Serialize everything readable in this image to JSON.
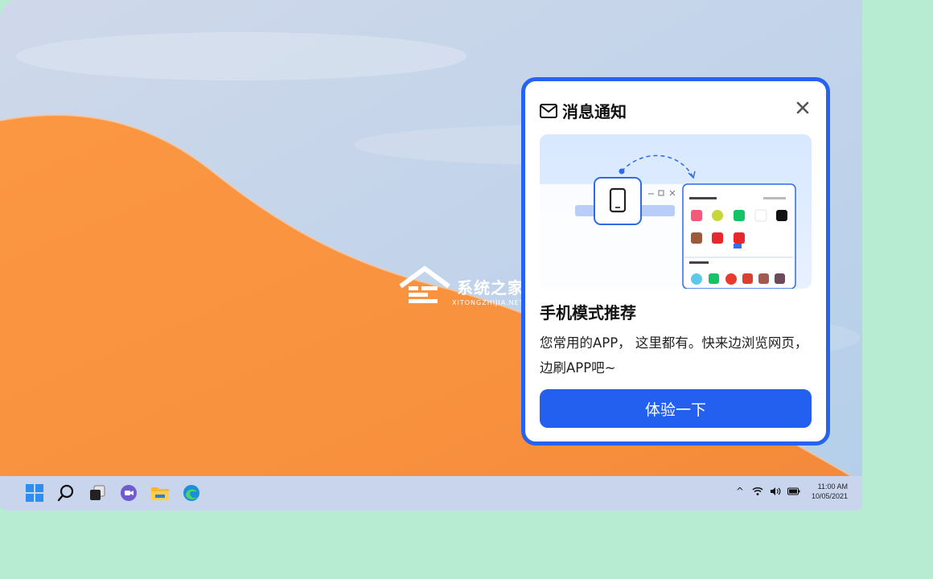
{
  "notification": {
    "title": "消息通知",
    "heading": "手机模式推荐",
    "description": "您常用的APP， 这里都有。快来边浏览网页，边刷APP吧~",
    "cta_label": "体验一下",
    "border_color": "#2563f0",
    "button_color": "#2460f0"
  },
  "watermark": {
    "text": "系统之家",
    "subtext": "XITONGZHIJIA.NET"
  },
  "taskbar": {
    "icons": [
      "windows-start-icon",
      "search-icon",
      "task-view-icon",
      "teams-chat-icon",
      "file-explorer-icon",
      "edge-browser-icon"
    ],
    "tray": {
      "chevron": "^",
      "time": "11:00 AM",
      "date": "10/05/2021"
    }
  },
  "colors": {
    "dune": "#f9923f",
    "background": "#b7ecd3",
    "taskbar": "#c9d5ec"
  }
}
